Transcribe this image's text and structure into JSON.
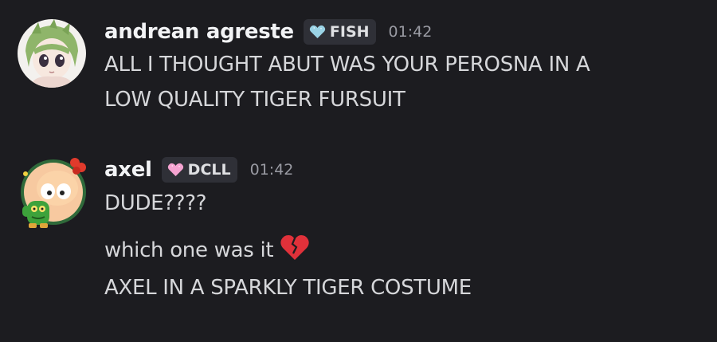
{
  "messages": [
    {
      "username": "andrean agreste",
      "tag": {
        "label": "FISH",
        "icon": "heart-icon",
        "color": "#9ad3e6"
      },
      "timestamp": "01:42",
      "lines": [
        "ALL I THOUGHT ABUT WAS YOUR PEROSNA IN A",
        "LOW QUALITY TIGER FURSUIT"
      ]
    },
    {
      "username": "axel",
      "tag": {
        "label": "DCLL",
        "icon": "heart-icon",
        "color": "#f5a3d1"
      },
      "timestamp": "01:42",
      "lines": [
        "DUDE????",
        "which one was it",
        "AXEL IN A SPARKLY TIGER COSTUME"
      ],
      "emoji": "broken-heart-icon"
    }
  ],
  "colors": {
    "background": "#1c1c20",
    "username": "#f2f3f5",
    "text": "#d6d7da",
    "timestamp": "#9a9ba3",
    "tag_bg": "#2f3037",
    "broken_heart": "#e0313a"
  }
}
